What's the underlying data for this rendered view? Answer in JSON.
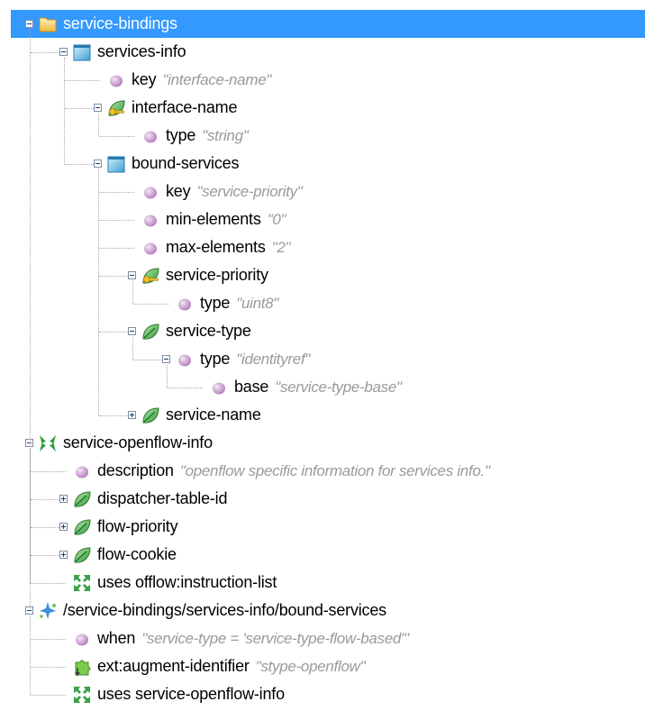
{
  "colors": {
    "selection": "#3399ff",
    "value_text": "#9a9a9a",
    "guide_lines": "#a8a8a8"
  },
  "tree": [
    {
      "name": "service-bindings",
      "icon": "folder-icon",
      "depth": 0,
      "toggle": "minus",
      "selected": true
    },
    {
      "name": "services-info",
      "icon": "list-icon",
      "depth": 1,
      "toggle": "minus"
    },
    {
      "name": "key",
      "value": "\"interface-name\"",
      "icon": "property-icon",
      "depth": 2
    },
    {
      "name": "interface-name",
      "icon": "key-leaf-icon",
      "depth": 2,
      "toggle": "minus"
    },
    {
      "name": "type",
      "value": "\"string\"",
      "icon": "property-icon",
      "depth": 3
    },
    {
      "name": "bound-services",
      "icon": "list-icon",
      "depth": 2,
      "toggle": "minus"
    },
    {
      "name": "key",
      "value": "\"service-priority\"",
      "icon": "property-icon",
      "depth": 3
    },
    {
      "name": "min-elements",
      "value": "\"0\"",
      "icon": "property-icon",
      "depth": 3
    },
    {
      "name": "max-elements",
      "value": "\"2\"",
      "icon": "property-icon",
      "depth": 3
    },
    {
      "name": "service-priority",
      "icon": "key-leaf-icon",
      "depth": 3,
      "toggle": "minus"
    },
    {
      "name": "type",
      "value": "\"uint8\"",
      "icon": "property-icon",
      "depth": 4
    },
    {
      "name": "service-type",
      "icon": "leaf-icon",
      "depth": 3,
      "toggle": "minus"
    },
    {
      "name": "type",
      "value": "\"identityref\"",
      "icon": "property-icon",
      "depth": 4,
      "toggle": "minus"
    },
    {
      "name": "base",
      "value": "\"service-type-base\"",
      "icon": "property-icon",
      "depth": 5
    },
    {
      "name": "service-name",
      "icon": "leaf-icon",
      "depth": 3,
      "toggle": "plus"
    },
    {
      "name": "service-openflow-info",
      "icon": "grouping-icon",
      "depth": 0,
      "toggle": "minus"
    },
    {
      "name": "description",
      "value": "\"openflow specific information for services info.\"",
      "icon": "property-icon",
      "depth": 1
    },
    {
      "name": "dispatcher-table-id",
      "icon": "leaf-icon",
      "depth": 1,
      "toggle": "plus"
    },
    {
      "name": "flow-priority",
      "icon": "leaf-icon",
      "depth": 1,
      "toggle": "plus"
    },
    {
      "name": "flow-cookie",
      "icon": "leaf-icon",
      "depth": 1,
      "toggle": "plus"
    },
    {
      "name": "uses offlow:instruction-list",
      "icon": "uses-icon",
      "depth": 1
    },
    {
      "name": "/service-bindings/services-info/bound-services",
      "icon": "augment-icon",
      "depth": 0,
      "toggle": "minus"
    },
    {
      "name": "when",
      "value": "\"service-type = 'service-type-flow-based'\"",
      "icon": "property-icon",
      "depth": 1
    },
    {
      "name": "ext:augment-identifier",
      "value": "\"stype-openflow\"",
      "icon": "extension-icon",
      "depth": 1
    },
    {
      "name": "uses service-openflow-info",
      "icon": "uses-icon",
      "depth": 1
    }
  ]
}
